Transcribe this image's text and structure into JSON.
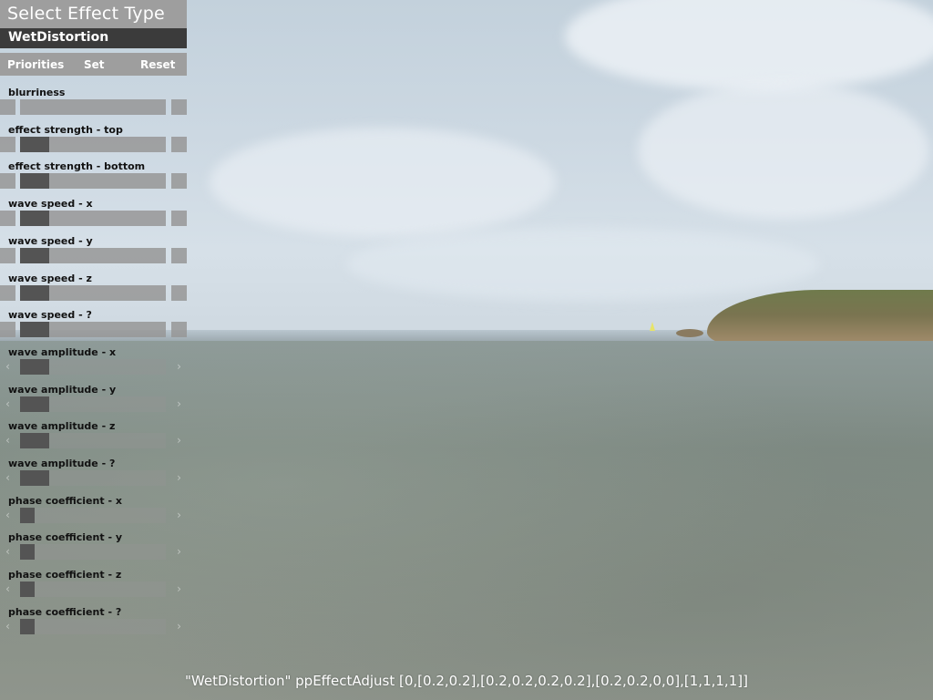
{
  "panel": {
    "title": "Select Effect Type",
    "effect_name": "WetDistortion",
    "actions": {
      "priorities": "Priorities",
      "set": "Set",
      "reset": "Reset"
    },
    "params": [
      {
        "label": "blurriness",
        "value": 0.0
      },
      {
        "label": "effect strength - top",
        "value": 0.2
      },
      {
        "label": "effect strength - bottom",
        "value": 0.2
      },
      {
        "label": "wave speed - x",
        "value": 0.2
      },
      {
        "label": "wave speed - y",
        "value": 0.2
      },
      {
        "label": "wave speed - z",
        "value": 0.2
      },
      {
        "label": "wave speed - ?",
        "value": 0.2
      },
      {
        "label": "wave amplitude - x",
        "value": 0.2
      },
      {
        "label": "wave amplitude - y",
        "value": 0.2
      },
      {
        "label": "wave amplitude - z",
        "value": 0.0
      },
      {
        "label": "wave amplitude - ?",
        "value": 0.0
      },
      {
        "label": "phase coefficient - x",
        "value": 1.0
      },
      {
        "label": "phase coefficient - y",
        "value": 1.0
      },
      {
        "label": "phase coefficient - z",
        "value": 1.0
      },
      {
        "label": "phase coefficient - ?",
        "value": 1.0
      }
    ]
  },
  "command_line": "\"WetDistortion\" ppEffectAdjust [0,[0.2,0.2],[0.2,0.2,0.2,0.2],[0.2,0.2,0,0],[1,1,1,1]]",
  "icons": {
    "slider_left": "chevron-left-icon",
    "slider_right": "chevron-right-icon"
  },
  "colors": {
    "panel_gray": "#9e9e9e",
    "effect_bar": "#3b3b3b",
    "slider_handle": "#545454"
  }
}
